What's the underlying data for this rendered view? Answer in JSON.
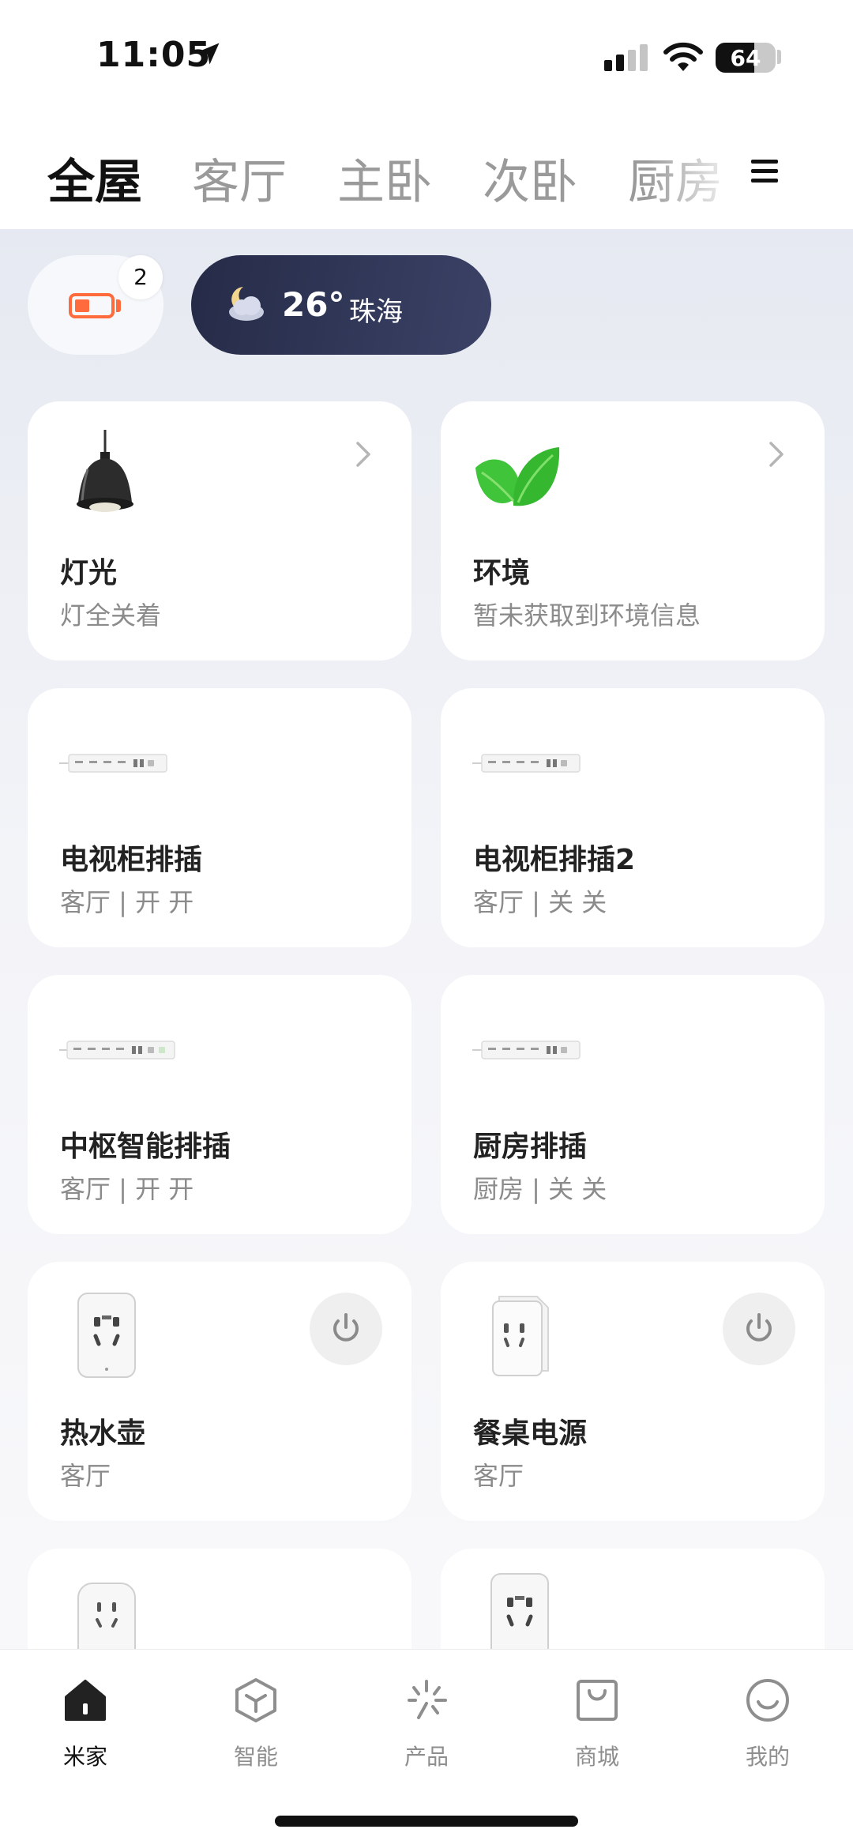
{
  "status_bar": {
    "time": "11:05",
    "battery": "64",
    "battery_level": 0.64
  },
  "rooms": {
    "tabs": [
      {
        "label": "全屋",
        "active": true
      },
      {
        "label": "客厅"
      },
      {
        "label": "主卧"
      },
      {
        "label": "次卧"
      },
      {
        "label": "厨房"
      }
    ]
  },
  "battery_alert": {
    "count": "2"
  },
  "weather": {
    "temp": "26°",
    "city": "珠海"
  },
  "cards": [
    {
      "title": "灯光",
      "subtitle": "灯全关着",
      "icon": "pendant-lamp-icon",
      "action": "chevron"
    },
    {
      "title": "环境",
      "subtitle": "暂未获取到环境信息",
      "icon": "leaf-icon",
      "action": "chevron"
    },
    {
      "title": "电视柜排插",
      "subtitle": "客厅 | 开 开",
      "icon": "power-strip-icon"
    },
    {
      "title": "电视柜排插2",
      "subtitle": "客厅 | 关 关",
      "icon": "power-strip-icon"
    },
    {
      "title": "中枢智能排插",
      "subtitle": "客厅 | 开 开",
      "icon": "power-strip-icon"
    },
    {
      "title": "厨房排插",
      "subtitle": "厨房 | 关 关",
      "icon": "power-strip-icon"
    },
    {
      "title": "热水壶",
      "subtitle": "客厅",
      "icon": "smart-plug-icon",
      "action": "power"
    },
    {
      "title": "餐桌电源",
      "subtitle": "客厅",
      "icon": "smart-plug-icon",
      "action": "power"
    }
  ],
  "bottom_nav": [
    {
      "label": "米家",
      "icon": "home-icon",
      "active": true
    },
    {
      "label": "智能",
      "icon": "cube-icon"
    },
    {
      "label": "产品",
      "icon": "sparkle-icon"
    },
    {
      "label": "商城",
      "icon": "shopping-bag-icon"
    },
    {
      "label": "我的",
      "icon": "smiley-icon"
    }
  ],
  "colors": {
    "accent_battery": "#ff6b3d",
    "weather_bg": "#2a3050",
    "leaf": "#3fc43a"
  }
}
